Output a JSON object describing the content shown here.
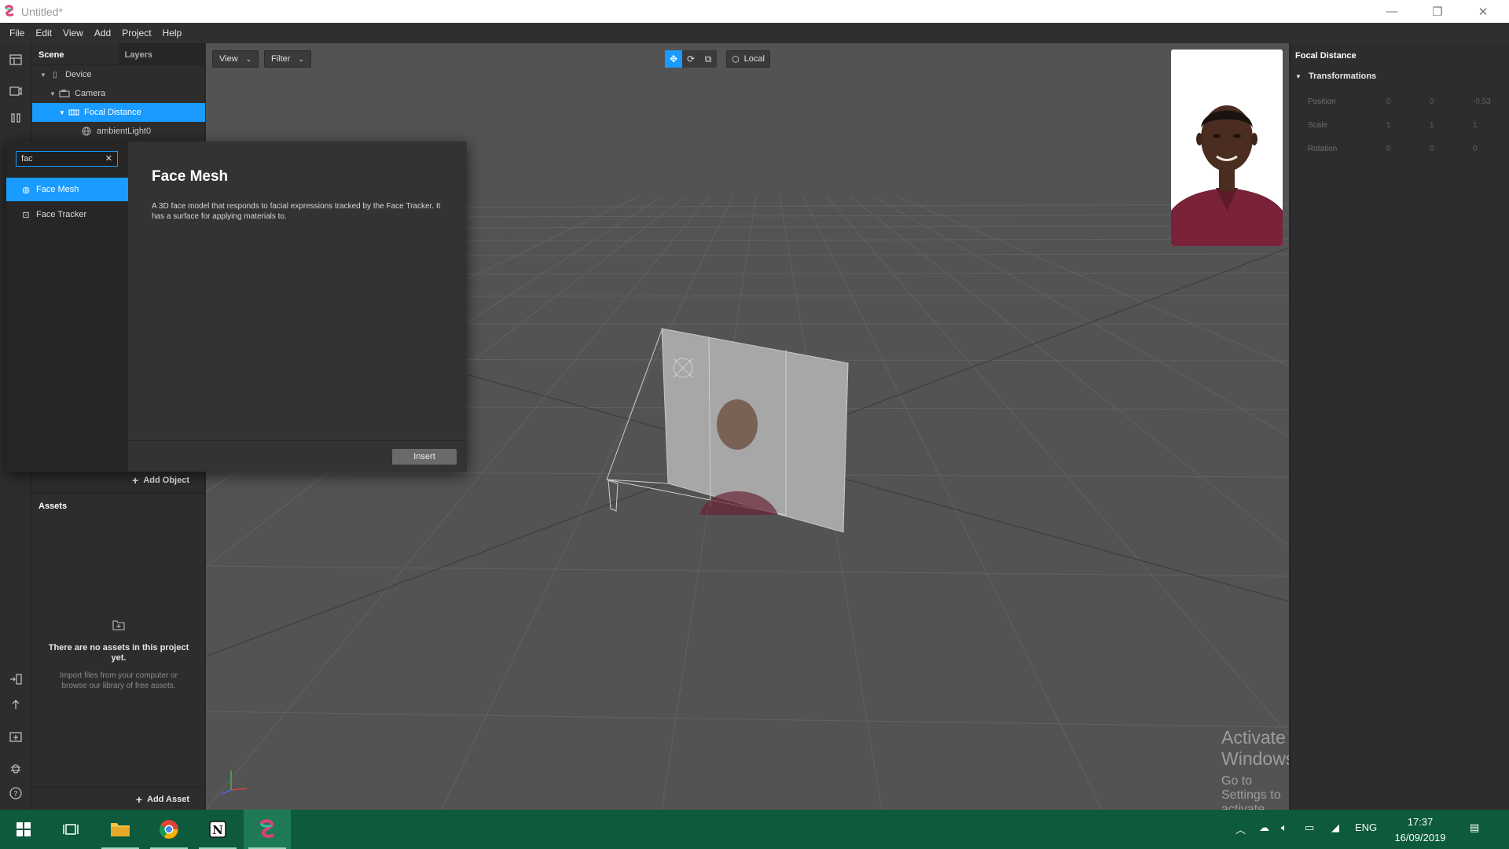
{
  "window": {
    "title": "Untitled*",
    "minimize": "—",
    "restore": "❐",
    "close": "✕"
  },
  "menu": [
    "File",
    "Edit",
    "View",
    "Add",
    "Project",
    "Help"
  ],
  "scene_panel": {
    "tabs": [
      "Scene",
      "Layers"
    ],
    "tree": [
      {
        "label": "Device"
      },
      {
        "label": "Camera"
      },
      {
        "label": "Focal Distance"
      },
      {
        "label": "ambientLight0"
      }
    ],
    "add_object": "Add Object"
  },
  "assets_panel": {
    "title": "Assets",
    "empty_title": "There are no assets in this project yet.",
    "empty_desc": "Import files from your computer or browse our library of free assets.",
    "add_asset": "Add Asset"
  },
  "viewport": {
    "view_label": "View",
    "filter_label": "Filter",
    "local_label": "Local"
  },
  "popup": {
    "search_value": "fac",
    "items": [
      "Face Mesh",
      "Face Tracker"
    ],
    "selected_title": "Face Mesh",
    "selected_desc": "A 3D face model that responds to facial expressions tracked by the Face Tracker. It has a surface for applying materials to.",
    "insert_label": "Insert"
  },
  "properties": {
    "title": "Focal Distance",
    "section": "Transformations",
    "rows": [
      {
        "label": "Position",
        "values": [
          "0",
          "0",
          "-0.53"
        ]
      },
      {
        "label": "Scale",
        "values": [
          "1",
          "1",
          "1"
        ]
      },
      {
        "label": "Rotation",
        "values": [
          "0",
          "0",
          "0"
        ]
      }
    ]
  },
  "watermark": {
    "line1": "Activate Windows",
    "line2": "Go to Settings to activate Windows."
  },
  "taskbar": {
    "lang": "ENG",
    "time": "17:37",
    "date": "16/09/2019"
  },
  "colors": {
    "accent": "#1a9bff",
    "taskbar": "#0d5a3c"
  }
}
